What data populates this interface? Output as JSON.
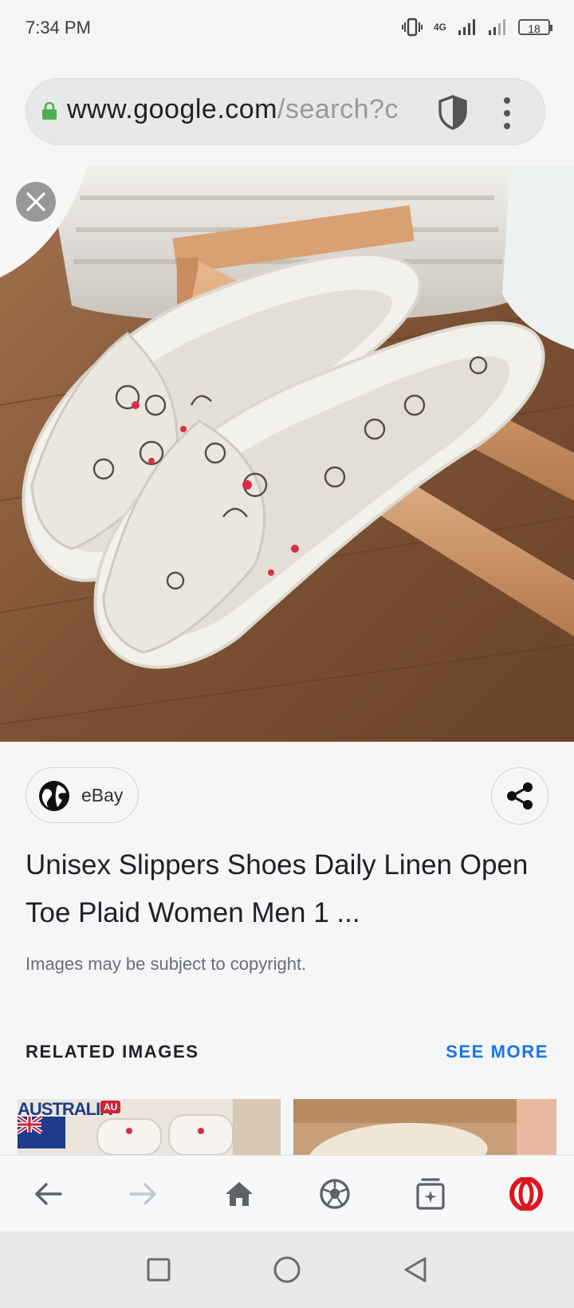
{
  "status_bar": {
    "time": "7:34 PM",
    "network": "4G",
    "battery": "18"
  },
  "browser": {
    "url_host": "www.google.com",
    "url_path": "/search?c"
  },
  "result": {
    "source": "eBay",
    "title": "Unisex Slippers Shoes Daily Linen Open Toe Plaid Women Men 1 ...",
    "copyright_notice": "Images may be subject to copyright."
  },
  "related": {
    "heading": "RELATED IMAGES",
    "see_more": "SEE MORE",
    "thumb1_brand": "AUSTRALIA",
    "thumb1_badge": "AU"
  },
  "colors": {
    "accent": "#1a73e8",
    "opera_red": "#e0141e",
    "lock_green": "#4caf50"
  },
  "icons": {
    "back": "arrow-left-icon",
    "forward": "arrow-right-icon",
    "home": "home-icon",
    "speed_dial": "soccer-ball-icon",
    "tabs": "tabs-icon",
    "menu": "opera-logo-icon"
  }
}
